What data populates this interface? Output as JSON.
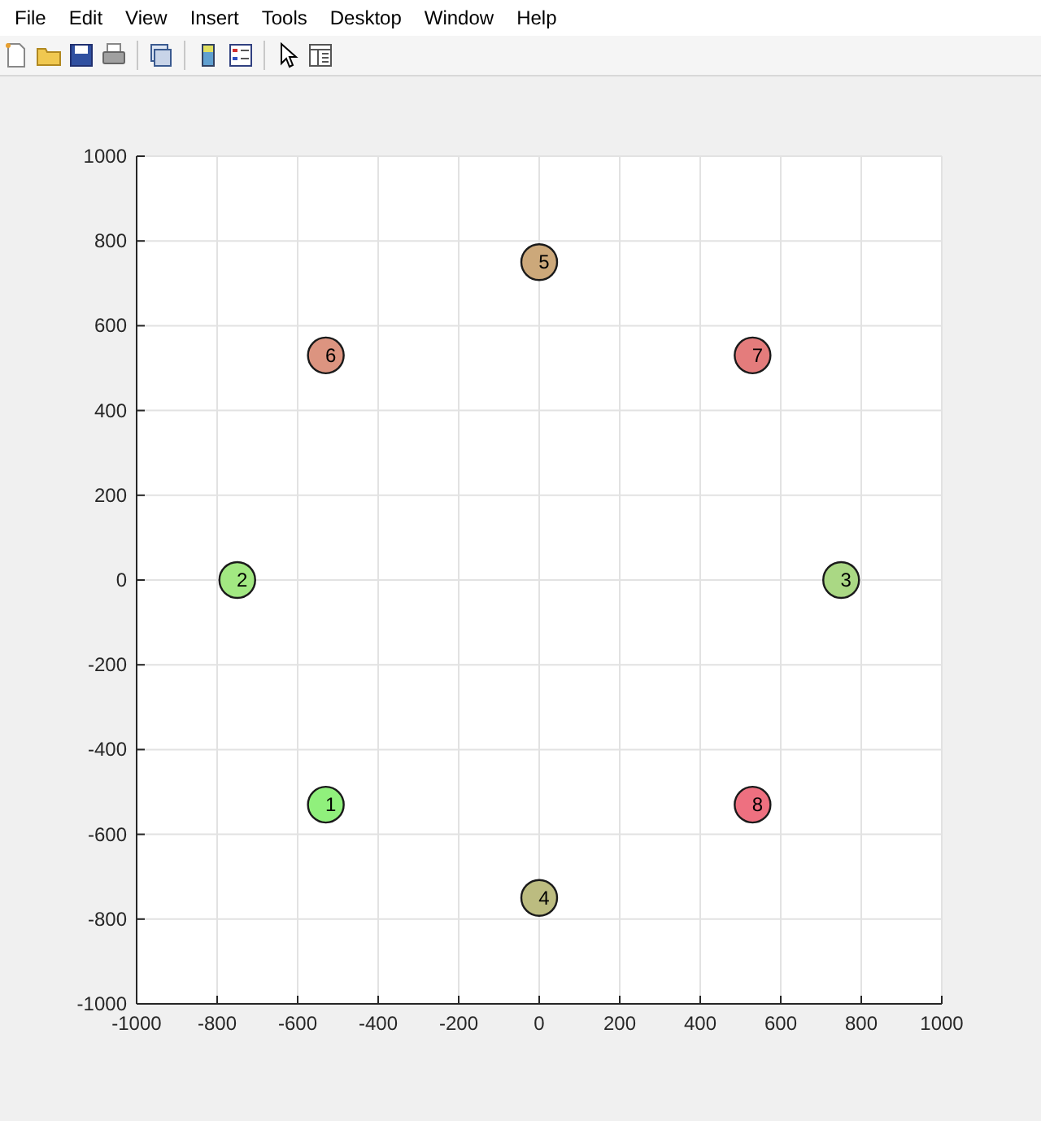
{
  "menu": [
    "File",
    "Edit",
    "View",
    "Insert",
    "Tools",
    "Desktop",
    "Window",
    "Help"
  ],
  "figure": {
    "chart_data": {
      "type": "scatter",
      "grid": true,
      "xlim": [
        -1000,
        1000
      ],
      "ylim": [
        -1000,
        1000
      ],
      "xticks": [
        -1000,
        -800,
        -600,
        -400,
        -200,
        0,
        200,
        400,
        600,
        800,
        1000
      ],
      "yticks": [
        -1000,
        -800,
        -600,
        -400,
        -200,
        0,
        200,
        400,
        600,
        800,
        1000
      ],
      "series": [
        {
          "name": "1",
          "color": "#90f07c",
          "x": [
            -530
          ],
          "values": [
            -530
          ]
        },
        {
          "name": "2",
          "color": "#a2e882",
          "x": [
            -750
          ],
          "values": [
            0
          ]
        },
        {
          "name": "3",
          "color": "#aad884",
          "x": [
            750
          ],
          "values": [
            0
          ]
        },
        {
          "name": "4",
          "color": "#bcbc80",
          "x": [
            0
          ],
          "values": [
            -750
          ]
        },
        {
          "name": "5",
          "color": "#cca87a",
          "x": [
            0
          ],
          "values": [
            750
          ]
        },
        {
          "name": "6",
          "color": "#dc9480",
          "x": [
            -530
          ],
          "values": [
            530
          ]
        },
        {
          "name": "7",
          "color": "#e47c7c",
          "x": [
            530
          ],
          "values": [
            530
          ]
        },
        {
          "name": "8",
          "color": "#ee7080",
          "x": [
            530
          ],
          "values": [
            -530
          ]
        }
      ]
    }
  }
}
